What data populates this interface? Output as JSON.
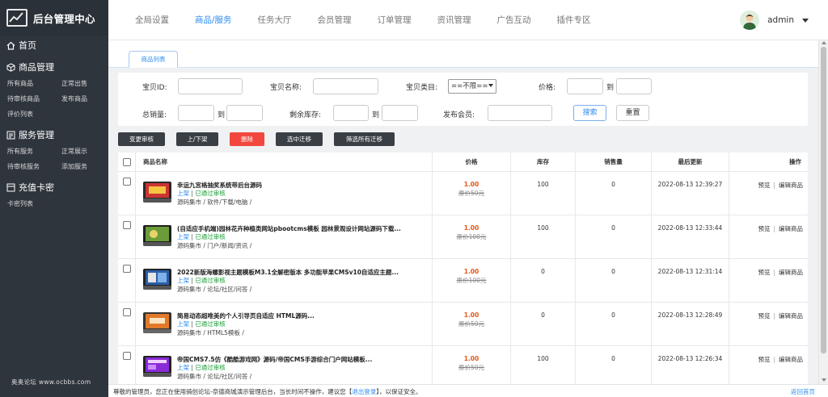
{
  "sidebar": {
    "brand": "后台管理中心",
    "home": "首页",
    "groups": [
      {
        "title": "商品管理",
        "items": [
          "所有商品",
          "正常出售",
          "待审核商品",
          "发布商品",
          "评价列表"
        ]
      },
      {
        "title": "服务管理",
        "items": [
          "所有服务",
          "正常展示",
          "待审核服务",
          "添加服务"
        ]
      },
      {
        "title": "充值卡密",
        "items": [
          "卡密列表"
        ]
      }
    ],
    "watermark": "奥奥论坛 www.ocbbs.com"
  },
  "topnav": {
    "tabs": [
      "全局设置",
      "商品/服务",
      "任务大厅",
      "会员管理",
      "订单管理",
      "资讯管理",
      "广告互动",
      "插件专区"
    ],
    "active_index": 1,
    "username": "admin"
  },
  "subtab": "商品列表",
  "filter": {
    "id_label": "宝贝ID:",
    "name_label": "宝贝名称:",
    "category_label": "宝贝类目:",
    "category_value": "==不限==",
    "price_label": "价格:",
    "to": "到",
    "sales_label": "总销量:",
    "stock_label": "剩余库存:",
    "member_label": "发布会员:",
    "search": "搜索",
    "reset": "重置"
  },
  "actions": [
    "变更审核",
    "上/下架",
    "删除",
    "选中迁移",
    "筛选所有迁移"
  ],
  "table": {
    "headers": [
      "商品名称",
      "价格",
      "库存",
      "销售量",
      "最后更新",
      "操作"
    ],
    "rows": [
      {
        "name": "幸运九宫格抽奖系统带后台源码",
        "shelf": "上架",
        "audit": "已通过审核",
        "category": "源码集市 / 软件/下载/电脑 /",
        "price": "1.00",
        "original": "原价50元",
        "stock": "100",
        "sales": "0",
        "updated": "2022-08-13 12:39:27"
      },
      {
        "name": "(自适应手机端)园林花卉种植类网站pbootcms模板 园林景观设计网站源码下载...",
        "shelf": "上架",
        "audit": "已通过审核",
        "category": "源码集市 / 门户/新闻/资讯 /",
        "price": "1.00",
        "original": "原价100元",
        "stock": "100",
        "sales": "0",
        "updated": "2022-08-13 12:33:44"
      },
      {
        "name": "2022新版海螺影视主题模板M3.1全解密版本 多功能苹果CMSv10自适应主题...",
        "shelf": "上架",
        "audit": "已通过审核",
        "category": "源码集市 / 论坛/社区/问答 /",
        "price": "1.00",
        "original": "原价100元",
        "stock": "0",
        "sales": "0",
        "updated": "2022-08-13 12:31:14"
      },
      {
        "name": "简易动态超唯美的个人引导页自适应 HTML源码...",
        "shelf": "上架",
        "audit": "已通过审核",
        "category": "源码集市 / HTML5模板 /",
        "price": "1.00",
        "original": "原价50元",
        "stock": "0",
        "sales": "0",
        "updated": "2022-08-13 12:28:49"
      },
      {
        "name": "帝国CMS7.5仿《酷酷游戏网》源码/帝国CMS手游综合门户网站模板...",
        "shelf": "上架",
        "audit": "已通过审核",
        "category": "源码集市 / 论坛/社区/问答 /",
        "price": "1.00",
        "original": "原价50元",
        "stock": "100",
        "sales": "0",
        "updated": "2022-08-13 12:26:34"
      }
    ],
    "op_preview": "预览",
    "op_edit": "编辑商品",
    "op_sep": "|",
    "status_sep": "|"
  },
  "footer": {
    "msg_before": "尊敬的管理员，您正在使用骑创论坛-奈德商城演示管理后台，当长时间不操作，建议您【",
    "logout": "退出登录",
    "msg_after": "】，以保证安全。",
    "back_home": "返回首页"
  },
  "colors": {
    "accent": "#2d8cf0",
    "danger": "#f2473f",
    "success": "#1aa034",
    "price": "#e8550f",
    "sidebar": "#2f353d"
  }
}
